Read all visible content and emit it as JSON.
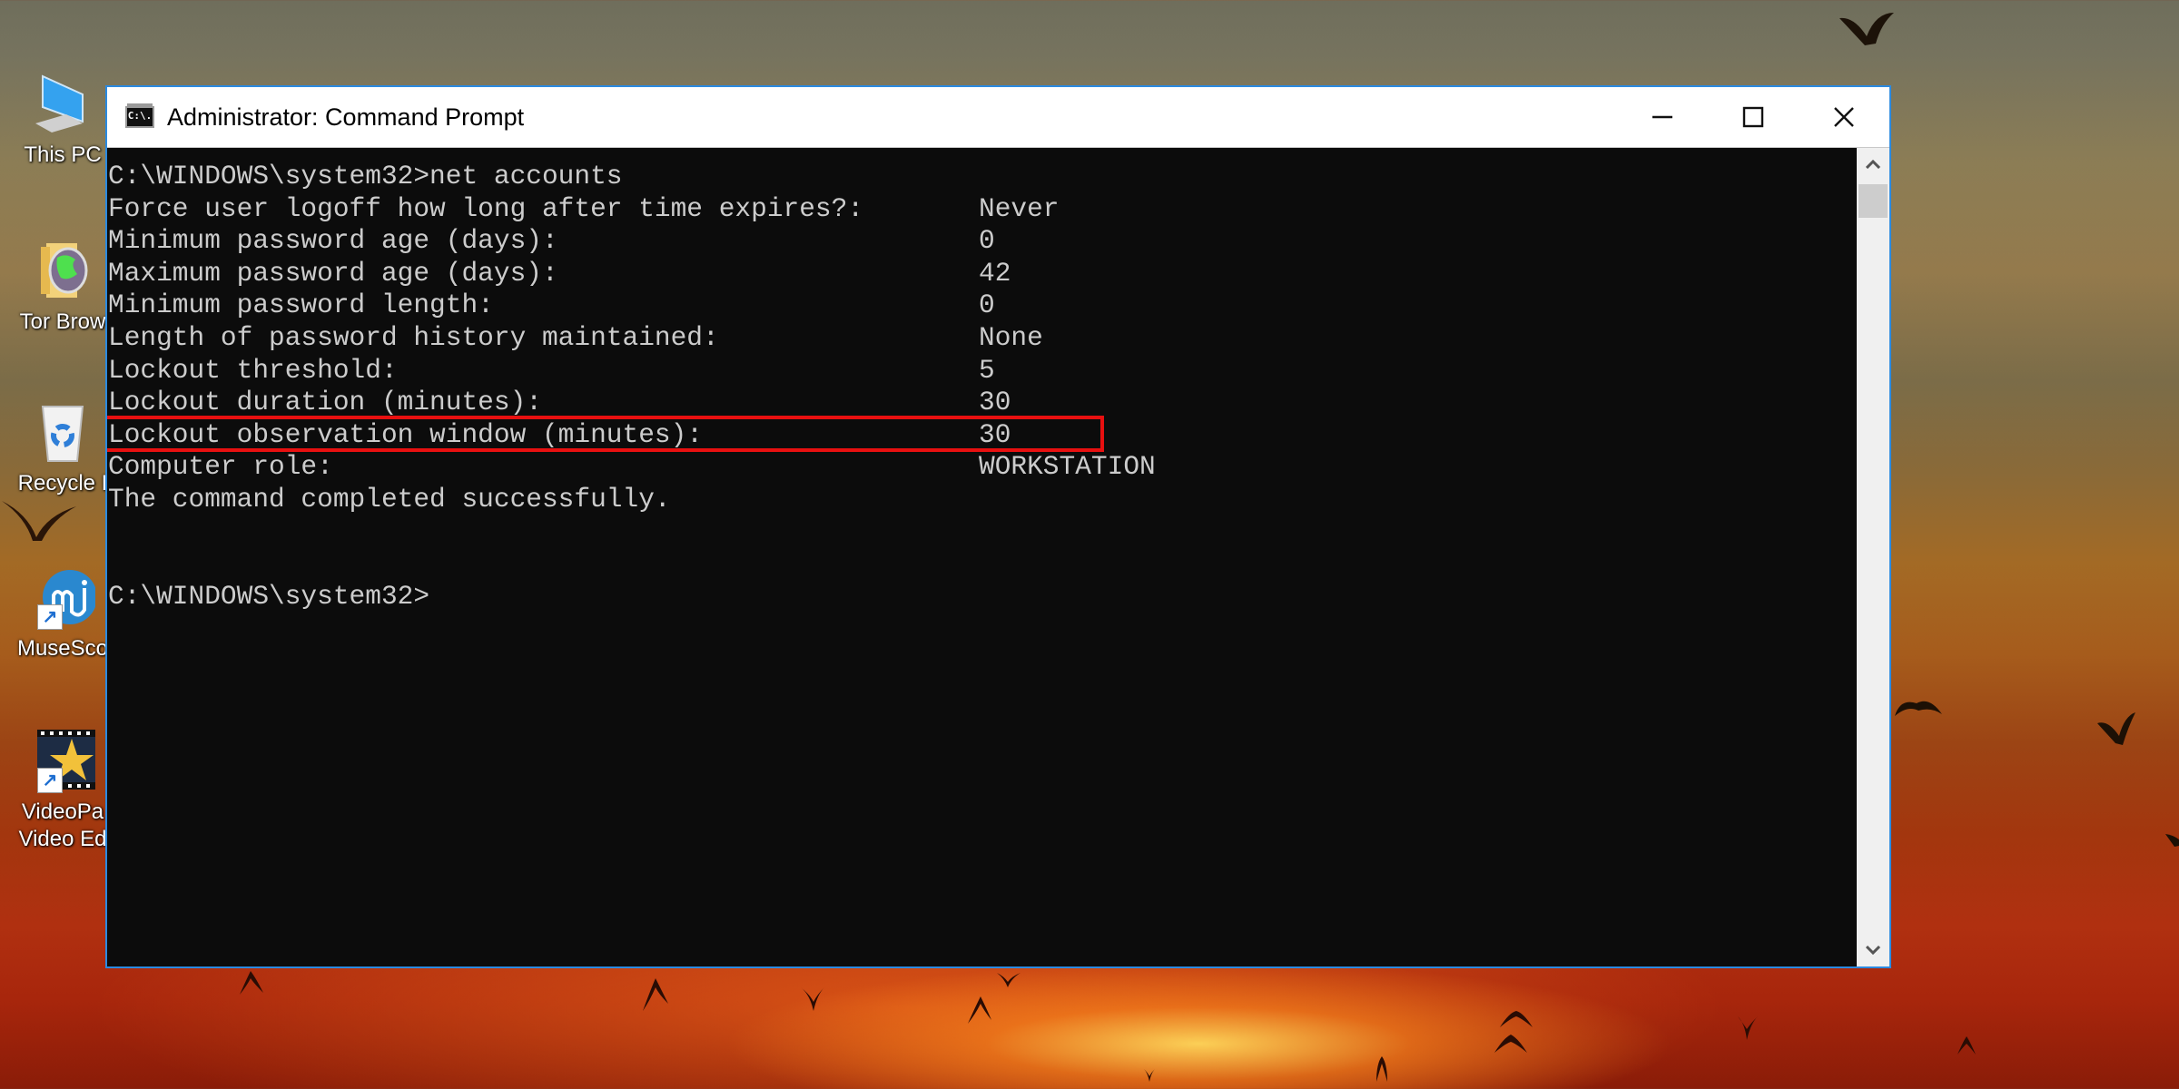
{
  "desktop": {
    "icons": [
      {
        "label": "This PC",
        "icon": "this-pc-icon"
      },
      {
        "label": "Tor Brow",
        "icon": "tor-browser-folder-icon"
      },
      {
        "label": "Recycle I",
        "icon": "recycle-bin-icon"
      },
      {
        "label": "MuseSco",
        "icon": "musescore-icon"
      },
      {
        "label": "VideoPa",
        "label2": "Video Ed",
        "icon": "videopad-icon"
      }
    ]
  },
  "window": {
    "title": "Administrator: Command Prompt",
    "icon_text": "C:\\.",
    "controls": {
      "minimize": "minimize-icon",
      "maximize": "maximize-icon",
      "close": "close-icon"
    },
    "accent_color": "#2b8ae0"
  },
  "console": {
    "command_line": "C:\\WINDOWS\\system32>net accounts",
    "rows": [
      {
        "label": "Force user logoff how long after time expires?:",
        "value": "Never"
      },
      {
        "label": "Minimum password age (days):",
        "value": "0"
      },
      {
        "label": "Maximum password age (days):",
        "value": "42"
      },
      {
        "label": "Minimum password length:",
        "value": "0"
      },
      {
        "label": "Length of password history maintained:",
        "value": "None"
      },
      {
        "label": "Lockout threshold:",
        "value": "5"
      },
      {
        "label": "Lockout duration (minutes):",
        "value": "30"
      },
      {
        "label": "Lockout observation window (minutes):",
        "value": "30",
        "highlighted": true
      },
      {
        "label": "Computer role:",
        "value": "WORKSTATION"
      }
    ],
    "status": "The command completed successfully.",
    "prompt": "C:\\WINDOWS\\system32>",
    "highlight_color": "#e81010"
  }
}
